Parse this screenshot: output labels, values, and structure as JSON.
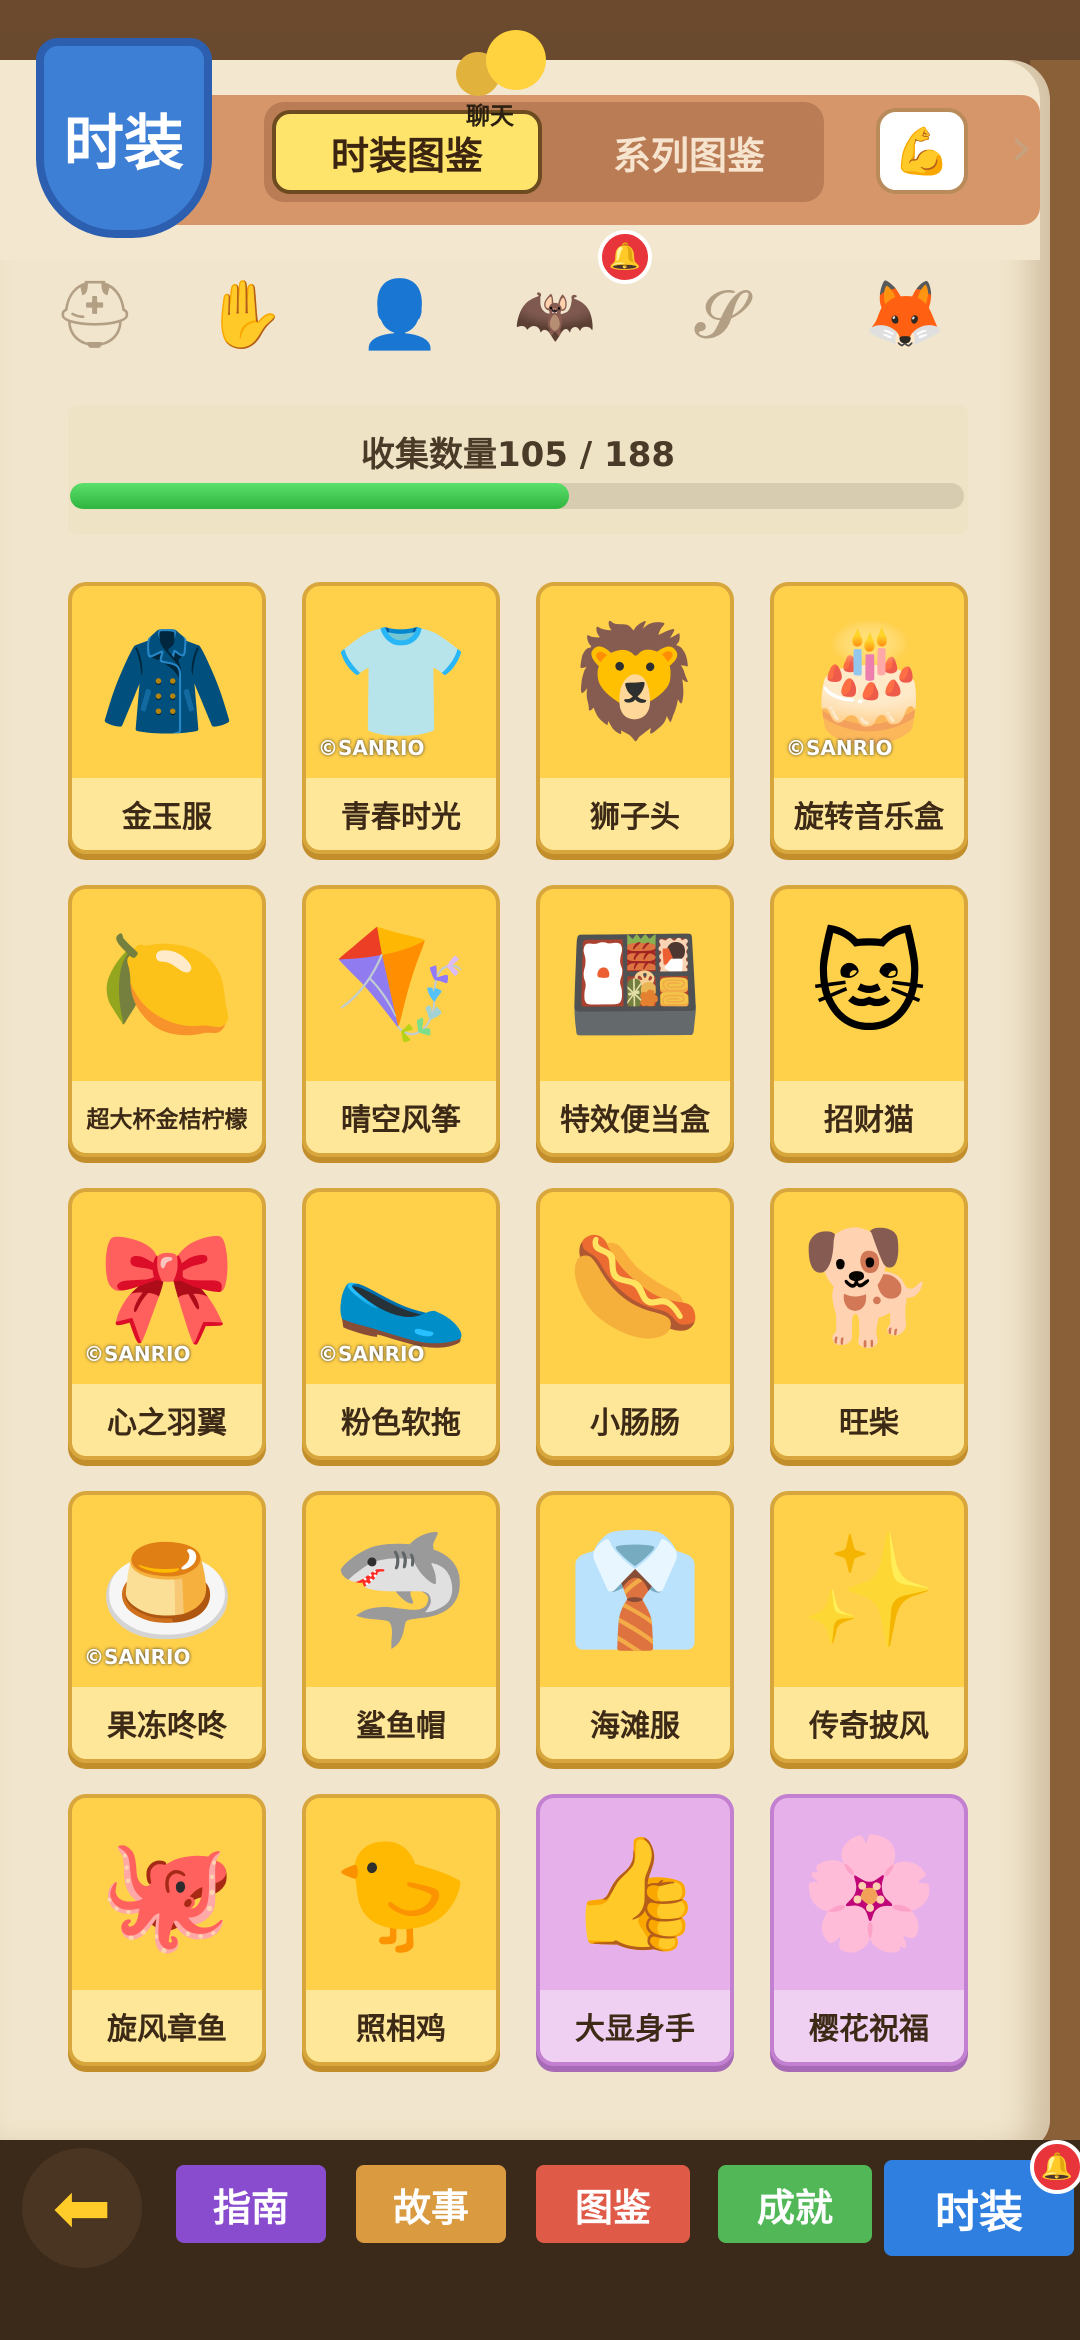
{
  "header": {
    "badge_title": "时装",
    "tabs": [
      {
        "label": "时装图鉴",
        "active": true
      },
      {
        "label": "系列图鉴",
        "active": false
      }
    ],
    "chat_label": "聊天"
  },
  "collection": {
    "label": "收集数量105 / 188",
    "collected": 105,
    "total": 188,
    "progress_fraction": 0.5585
  },
  "items": [
    {
      "name": "金玉服",
      "icon": "🧥",
      "sanrio": ""
    },
    {
      "name": "青春时光",
      "icon": "👕",
      "sanrio": "©SANRIO"
    },
    {
      "name": "狮子头",
      "icon": "🦁",
      "sanrio": ""
    },
    {
      "name": "旋转音乐盒",
      "icon": "🎂",
      "sanrio": "©SANRIO"
    },
    {
      "name": "超大杯金桔柠檬",
      "icon": "🍋",
      "sanrio": ""
    },
    {
      "name": "晴空风筝",
      "icon": "🪁",
      "sanrio": ""
    },
    {
      "name": "特效便当盒",
      "icon": "🍱",
      "sanrio": ""
    },
    {
      "name": "招财猫",
      "icon": "🐱",
      "sanrio": ""
    },
    {
      "name": "心之羽翼",
      "icon": "🎀",
      "sanrio": "©SANRIO"
    },
    {
      "name": "粉色软拖",
      "icon": "🥿",
      "sanrio": "©SANRIO"
    },
    {
      "name": "小肠肠",
      "icon": "🌭",
      "sanrio": ""
    },
    {
      "name": "旺柴",
      "icon": "🐕",
      "sanrio": ""
    },
    {
      "name": "果冻咚咚",
      "icon": "🍮",
      "sanrio": "©SANRIO"
    },
    {
      "name": "鲨鱼帽",
      "icon": "🦈",
      "sanrio": ""
    },
    {
      "name": "海滩服",
      "icon": "👔",
      "sanrio": ""
    },
    {
      "name": "传奇披风",
      "icon": "✨",
      "sanrio": ""
    },
    {
      "name": "旋风章鱼",
      "icon": "🐙",
      "sanrio": ""
    },
    {
      "name": "照相鸡",
      "icon": "🐤",
      "sanrio": ""
    },
    {
      "name": "大显身手",
      "icon": "👍",
      "sanrio": ""
    },
    {
      "name": "樱花祝福",
      "icon": "🌸",
      "sanrio": ""
    }
  ],
  "bottom_nav": [
    {
      "label": "指南"
    },
    {
      "label": "故事"
    },
    {
      "label": "图鉴"
    },
    {
      "label": "成就"
    },
    {
      "label": "时装"
    }
  ],
  "colors": {
    "card_gold": "#ffd04a",
    "card_purple": "#e6b0ea",
    "progress_green": "#2fb43f",
    "badge_blue": "#3e7fd6"
  }
}
